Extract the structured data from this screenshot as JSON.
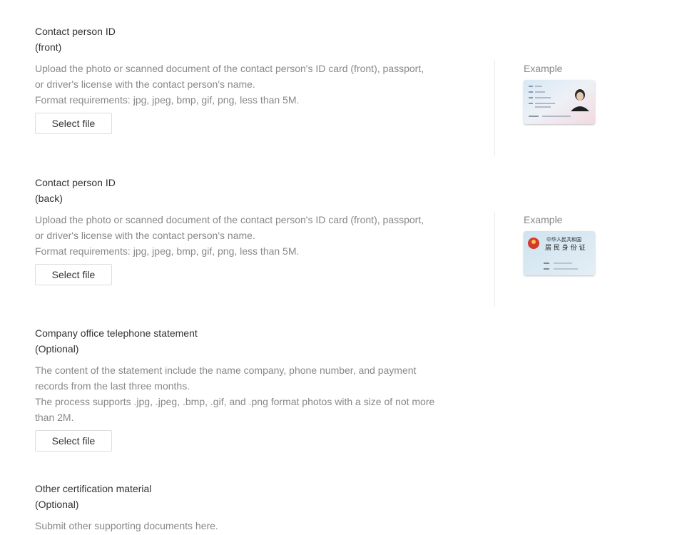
{
  "sections": [
    {
      "title": "Contact person ID",
      "subtitle": "(front)",
      "desc": [
        "Upload the photo or scanned document of the contact person's ID card (front), passport,",
        "or driver's license with the contact person's name.",
        "Format requirements: jpg, jpeg, bmp, gif, png, less than 5M."
      ],
      "button": "Select file",
      "example_label": "Example"
    },
    {
      "title": "Contact person ID",
      "subtitle": "(back)",
      "desc": [
        "Upload the photo or scanned document of the contact person's ID card (front), passport,",
        "or driver's license with the contact person's name.",
        "Format requirements: jpg, jpeg, bmp, gif, png, less than 5M."
      ],
      "button": "Select file",
      "example_label": "Example",
      "card_text": [
        "中华人民共和国",
        "居 民 身 份 证"
      ]
    },
    {
      "title": "Company office telephone statement",
      "subtitle": "(Optional)",
      "desc": [
        "The content of the statement include the name company, phone number, and payment",
        "records from the last three months.",
        "The process supports .jpg, .jpeg, .bmp, .gif, and .png format photos with a size of not more",
        "than 2M."
      ],
      "button": "Select file"
    },
    {
      "title": "Other certification material",
      "subtitle": "(Optional)",
      "desc": [
        "Submit other supporting documents here."
      ]
    }
  ]
}
